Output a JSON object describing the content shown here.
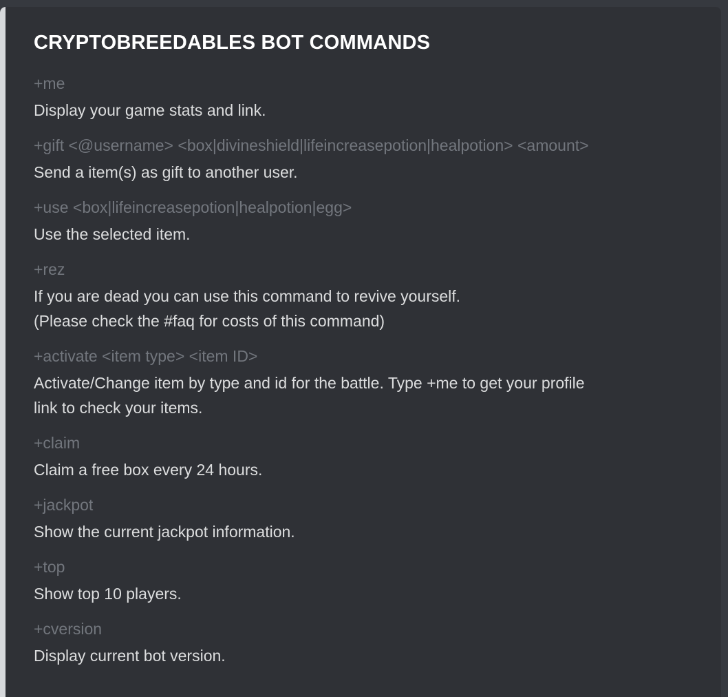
{
  "embed": {
    "title": "CRYPTOBREEDABLES BOT COMMANDS",
    "fields": [
      {
        "name": "+me",
        "value": "Display your game stats and link."
      },
      {
        "name": "+gift <@username> <box|divineshield|lifeincreasepotion|healpotion> <amount>",
        "value": "Send a item(s) as gift to another user."
      },
      {
        "name": "+use <box|lifeincreasepotion|healpotion|egg>",
        "value": "Use the selected item."
      },
      {
        "name": "+rez",
        "value": "If you are dead you can use this command to revive yourself.\n(Please check the #faq for costs of this command)"
      },
      {
        "name": "+activate <item type> <item ID>",
        "value": "Activate/Change item by type and id for the battle. Type +me to get your profile\nlink to check your items."
      },
      {
        "name": "+claim",
        "value": "Claim a free box every 24 hours."
      },
      {
        "name": "+jackpot",
        "value": "Show the current jackpot information."
      },
      {
        "name": "+top",
        "value": "Show top 10 players."
      },
      {
        "name": "+cversion",
        "value": "Display current bot version."
      }
    ]
  },
  "colors": {
    "background": "#36393f",
    "embed_background": "#2f3136",
    "embed_accent_bar": "#d7d9dc",
    "title": "#ffffff",
    "field_name": "#72767d",
    "field_value": "#dcddde"
  }
}
